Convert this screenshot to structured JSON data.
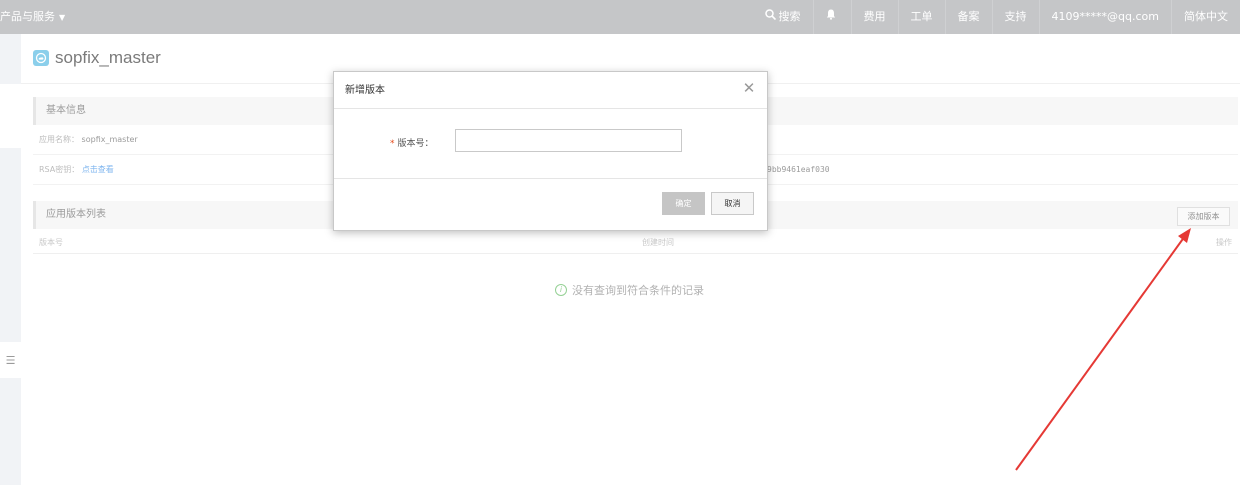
{
  "topbar": {
    "products_label": "产品与服务",
    "search_label": "搜索",
    "fee_label": "费用",
    "ticket_label": "工单",
    "record_label": "备案",
    "support_label": "支持",
    "account": "4109*****@qq.com",
    "language": "简体中文"
  },
  "app": {
    "title": "sopfix_master"
  },
  "basic_info": {
    "section_title": "基本信息",
    "app_name_label": "应用名称：",
    "app_name_value": "sopfix_master",
    "rsa_label": "RSA密钥：",
    "rsa_link": "点击查看",
    "key_tail": "9bb9461eaf030"
  },
  "versions": {
    "section_title": "应用版本列表",
    "add_button": "添加版本",
    "columns": [
      "版本号",
      "创建时间",
      "操作"
    ],
    "empty_text": "没有查询到符合条件的记录"
  },
  "modal": {
    "title": "新增版本",
    "required_mark": "*",
    "field_label": "版本号：",
    "field_value": "",
    "confirm_button": "确定",
    "cancel_button": "取消"
  },
  "colors": {
    "topbar": "#a6a8ab",
    "annotation_arrow": "#e53935",
    "link": "#3a8ee6"
  }
}
